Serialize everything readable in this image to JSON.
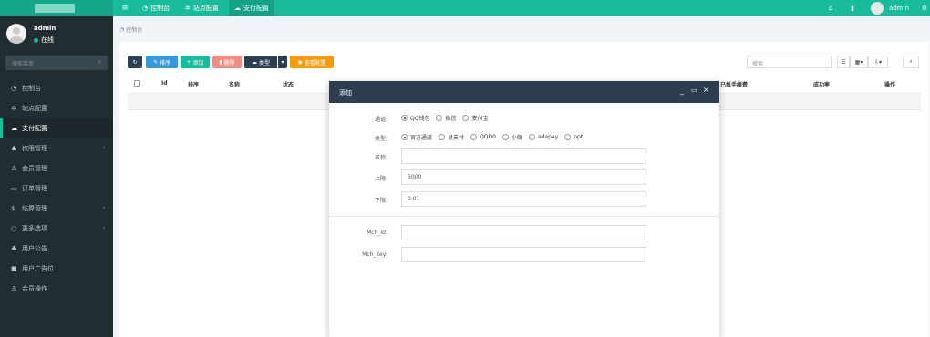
{
  "topbar": {
    "menu_icon": "bars-icon",
    "tabs": [
      {
        "label": "控制台",
        "icon": "dashboard-icon"
      },
      {
        "label": "站点配置",
        "icon": "gear-icon"
      },
      {
        "label": "支付配置",
        "icon": "cloud-icon"
      }
    ],
    "user": "admin"
  },
  "sidebar": {
    "username": "admin",
    "status": "在线",
    "search_placeholder": "搜索菜单",
    "items": [
      {
        "label": "控制台",
        "icon": "dashboard-icon"
      },
      {
        "label": "站点配置",
        "icon": "gear-icon"
      },
      {
        "label": "支付配置",
        "icon": "cloud-icon",
        "active": true
      },
      {
        "label": "权限管理",
        "icon": "group-icon",
        "has_children": true
      },
      {
        "label": "会员管理",
        "icon": "user-icon"
      },
      {
        "label": "订单管理",
        "icon": "file-icon"
      },
      {
        "label": "结算管理",
        "icon": "dollar-icon",
        "has_children": true
      },
      {
        "label": "更多选项",
        "icon": "circle-icon",
        "has_children": true
      },
      {
        "label": "用户公告",
        "icon": "bell-icon"
      },
      {
        "label": "用户广告位",
        "icon": "square-icon"
      },
      {
        "label": "会员操作",
        "icon": "user-icon"
      }
    ]
  },
  "breadcrumb": "控制台",
  "toolbar": {
    "sort": "排序",
    "add": "添加",
    "delete": "删除",
    "type": "类型",
    "view_config": "查看配置",
    "search_placeholder": "搜索"
  },
  "table": {
    "headers": [
      "Id",
      "排序",
      "名称",
      "状态",
      "已抵手续费",
      "成功率",
      "操作"
    ]
  },
  "modal": {
    "title": "添加",
    "channel_label": "通道:",
    "channel_options": [
      "QQ钱包",
      "微信",
      "支付宝"
    ],
    "channel_selected": 0,
    "type_label": "类型:",
    "type_options": [
      "官方通道",
      "易支付",
      "QQD0",
      "小微",
      "adapay",
      "ppt"
    ],
    "type_selected": 0,
    "name_label": "名称:",
    "name_value": "",
    "upper_label": "上限:",
    "upper_value": "5000",
    "lower_label": "下限:",
    "lower_value": "0.01",
    "mch_id_label": "Mch_Id:",
    "mch_id_value": "",
    "mch_key_label": "Mch_Key:",
    "mch_key_value": ""
  },
  "colors": {
    "primary": "#18bc9c",
    "sidebar_bg": "#222d32",
    "modal_header": "#2c3e50",
    "warning": "#f39c12",
    "danger": "#f08d85",
    "info": "#3498db"
  }
}
